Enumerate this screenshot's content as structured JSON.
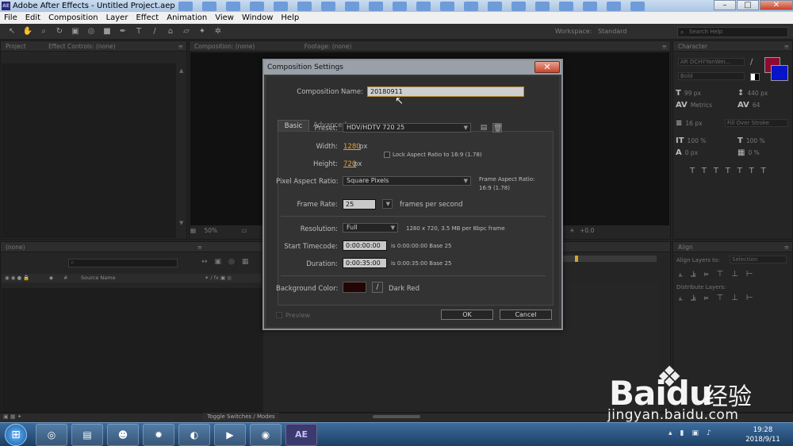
{
  "window": {
    "title": "Adobe After Effects - Untitled Project.aep",
    "app_icon": "AE",
    "minimize": "–",
    "maximize": "□",
    "close": "✕"
  },
  "menubar": [
    "File",
    "Edit",
    "Composition",
    "Layer",
    "Effect",
    "Animation",
    "View",
    "Window",
    "Help"
  ],
  "toolbar": {
    "workspace_label": "Workspace:",
    "workspace_value": "Standard",
    "search_placeholder": "Search Help"
  },
  "panels": {
    "project_tab": "Project",
    "effect_controls_tab": "Effect Controls: (none)",
    "composition_tab": "Composition: (none)",
    "footage_tab": "Footage: (none)",
    "character_tab": "Character",
    "timeline_tab": "(none)",
    "align_tab": "Align",
    "zoom": "50%",
    "exposure": "+0.0",
    "source_name_header": "Source Name",
    "toggle_switches": "Toggle Switches / Modes"
  },
  "character": {
    "font_family": "AR DCHYYanWei...",
    "font_style": "Bold",
    "font_size": "99 px",
    "leading": "440 px",
    "kerning": "Metrics",
    "tracking": "64",
    "stroke_width": "16 px",
    "stroke_type": "Fill Over Stroke",
    "vertical_scale": "100 %",
    "horizontal_scale": "100 %",
    "baseline_shift": "0 px",
    "tsume": "0 %",
    "fill_color": "#8f0a2e",
    "stroke_color": "#0714c7"
  },
  "align": {
    "align_layers_to": "Align Layers to:",
    "align_target": "Selection",
    "distribute_layers": "Distribute Layers:"
  },
  "dialog": {
    "title": "Composition Settings",
    "composition_name_label": "Composition Name:",
    "composition_name_value": "20180911",
    "tabs": [
      "Basic",
      "Advanced"
    ],
    "preset_label": "Preset:",
    "preset_value": "HDV/HDTV 720 25",
    "width_label": "Width:",
    "width_value": "1280",
    "width_unit": "px",
    "height_label": "Height:",
    "height_value": "720",
    "height_unit": "px",
    "lock_aspect_label": "Lock Aspect Ratio to 16:9 (1.78)",
    "lock_aspect_checked": false,
    "par_label": "Pixel Aspect Ratio:",
    "par_value": "Square Pixels",
    "frame_aspect_label": "Frame Aspect Ratio:",
    "frame_aspect_value": "16:9 (1.78)",
    "frame_rate_label": "Frame Rate:",
    "frame_rate_value": "25",
    "frame_rate_unit": "frames per second",
    "resolution_label": "Resolution:",
    "resolution_value": "Full",
    "resolution_info": "1280 x 720, 3.5 MB per 8bpc frame",
    "start_timecode_label": "Start Timecode:",
    "start_timecode_value": "0:00:00:00",
    "start_timecode_info": "is 0:00:00:00  Base 25",
    "duration_label": "Duration:",
    "duration_value": "0:00:35:00",
    "duration_info": "is 0:00:35:00  Base 25",
    "bg_color_label": "Background Color:",
    "bg_color_name": "Dark Red",
    "bg_color_hex": "#230505",
    "preview_label": "Preview",
    "ok_label": "OK",
    "cancel_label": "Cancel"
  },
  "watermark": {
    "brand": "Bai",
    "brand_tail": "du",
    "cn": "经验",
    "url": "jingyan.baidu.com"
  },
  "taskbar": {
    "ae_label": "AE",
    "time": "19:28",
    "date": "2018/9/11"
  }
}
